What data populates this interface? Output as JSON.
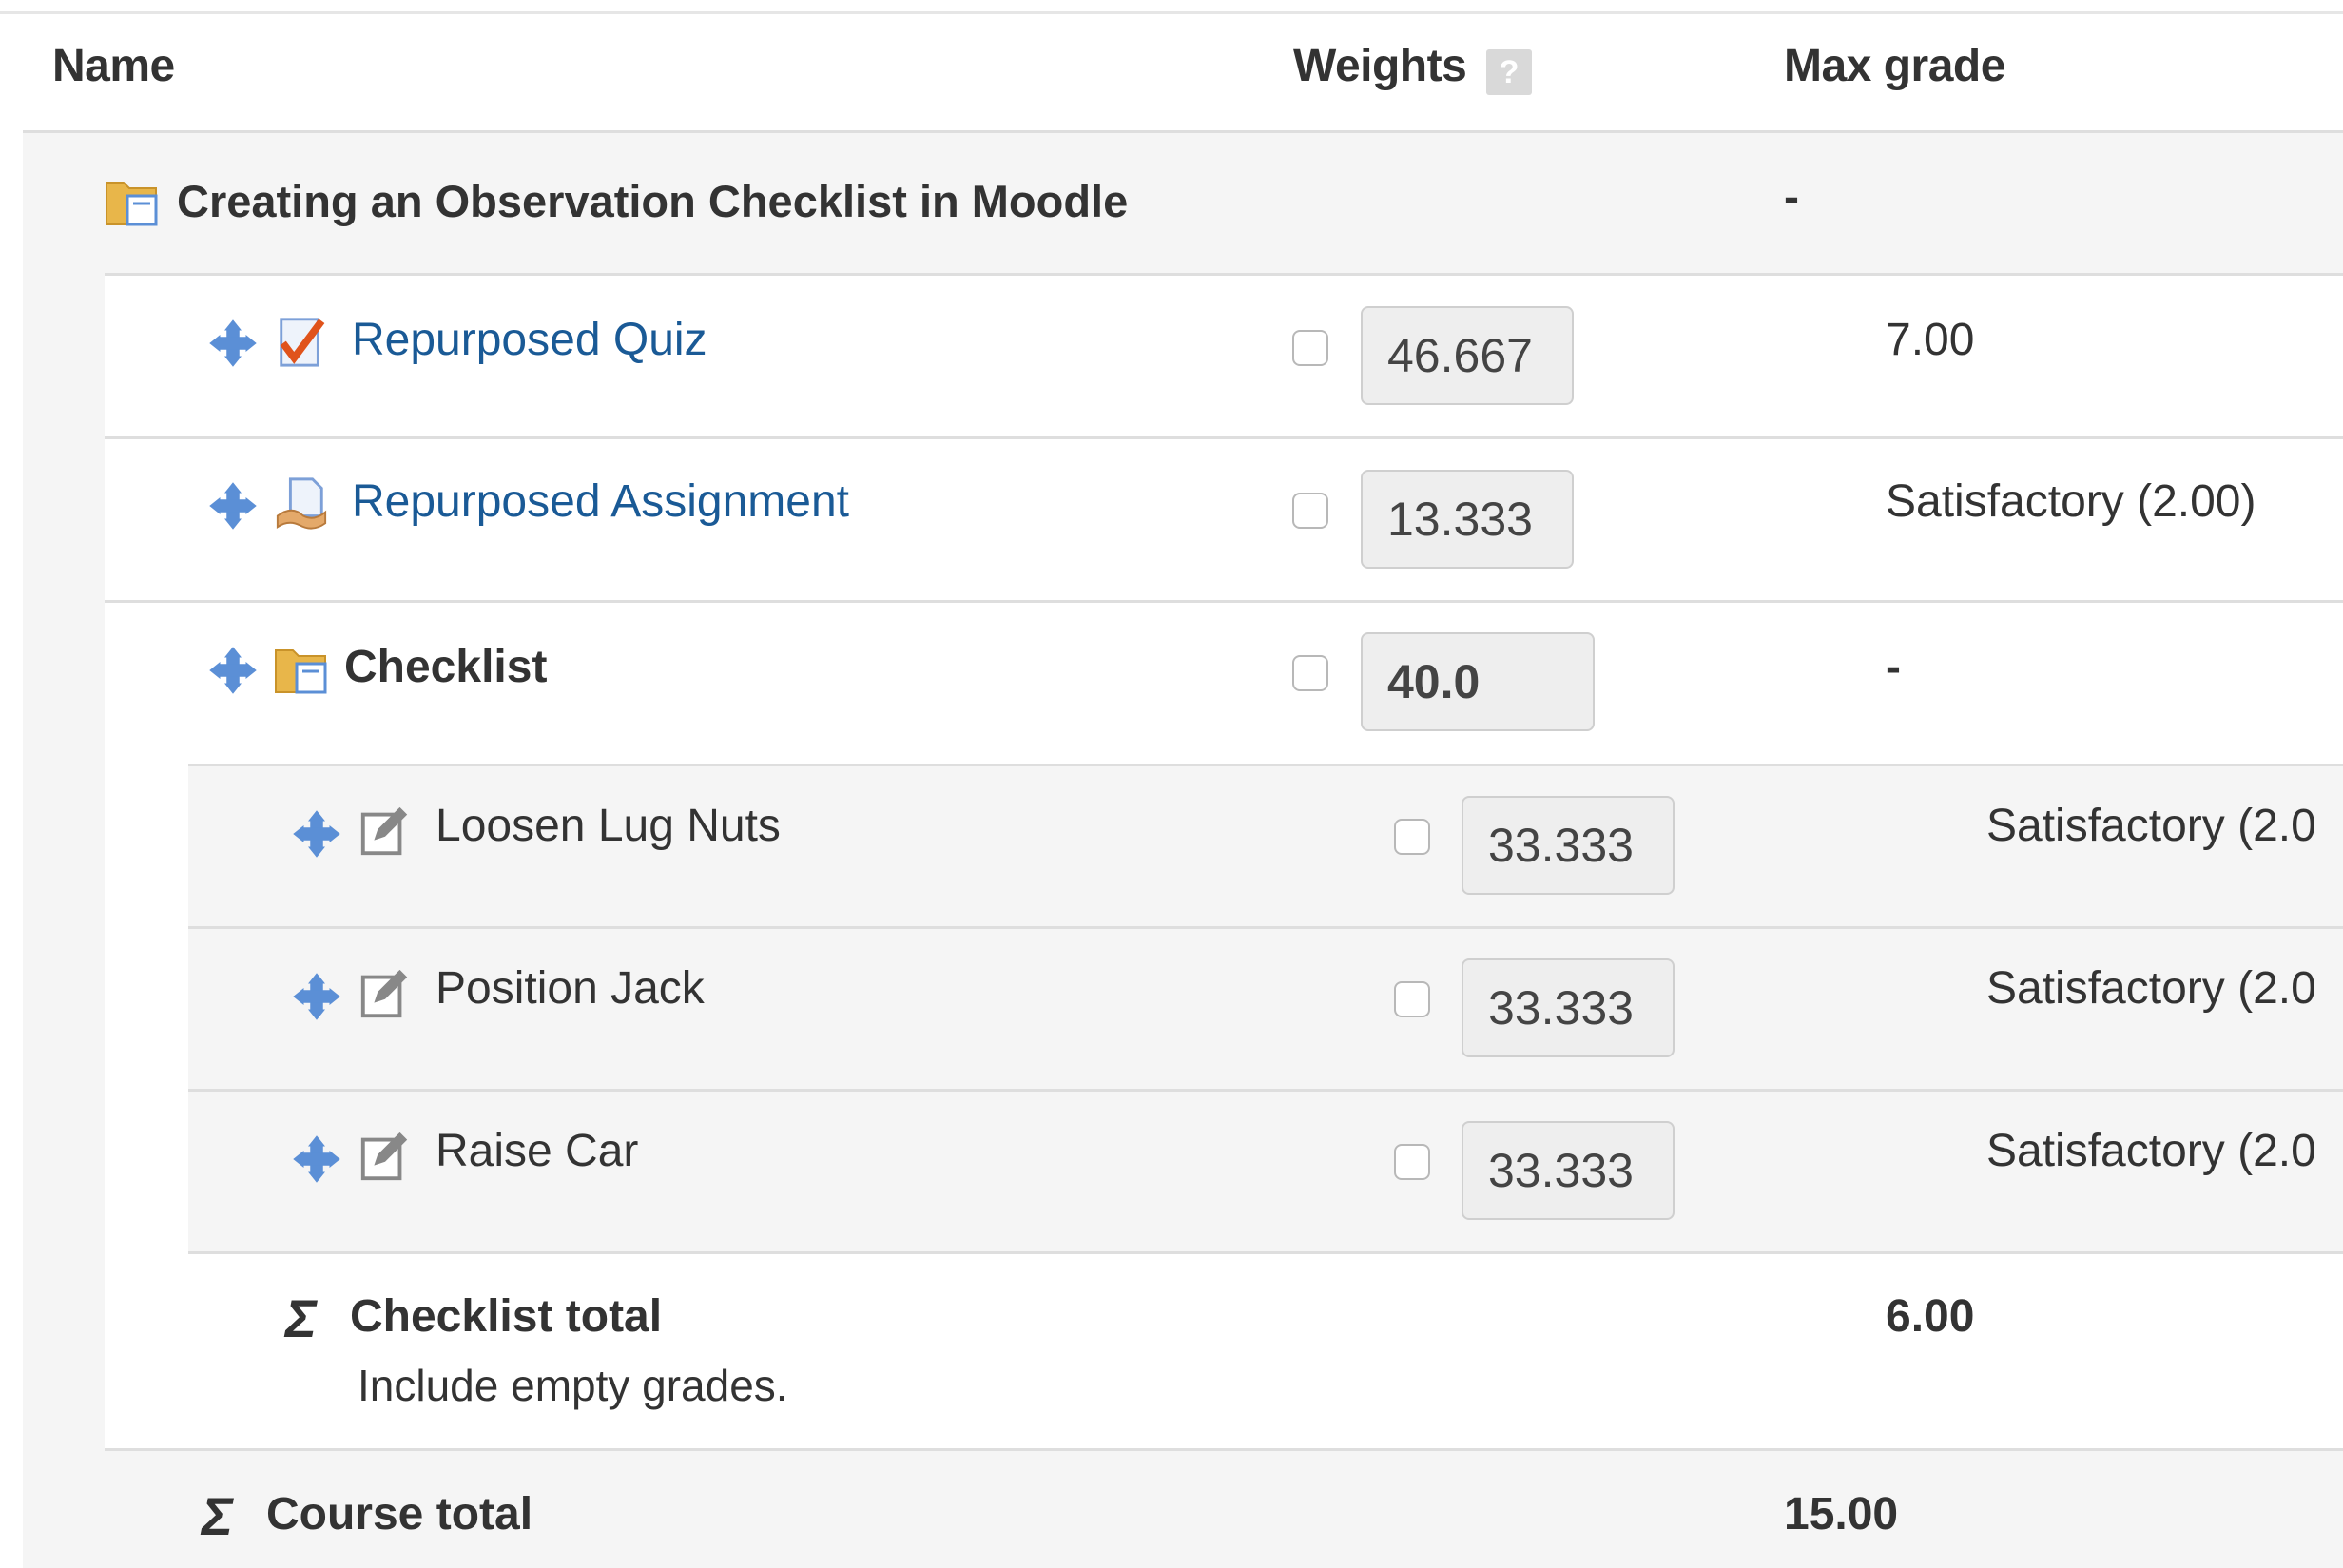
{
  "header": {
    "name": "Name",
    "weights": "Weights",
    "help_icon_glyph": "?",
    "max_grade": "Max grade"
  },
  "category": {
    "name": "Creating an Observation Checklist in Moodle",
    "max_grade": "-"
  },
  "items": [
    {
      "name": "Repurposed Quiz",
      "weight": "46.667",
      "max_grade": "7.00",
      "icon": "quiz-icon"
    },
    {
      "name": "Repurposed Assignment",
      "weight": "13.333",
      "max_grade": "Satisfactory (2.00)",
      "icon": "assignment-icon"
    }
  ],
  "checklist": {
    "name": "Checklist",
    "weight": "40.0",
    "max_grade": "-"
  },
  "sub_items": [
    {
      "name": "Loosen Lug Nuts",
      "weight": "33.333",
      "max_grade": "Satisfactory (2.0"
    },
    {
      "name": "Position Jack",
      "weight": "33.333",
      "max_grade": "Satisfactory (2.0"
    },
    {
      "name": "Raise Car",
      "weight": "33.333",
      "max_grade": "Satisfactory (2.0"
    }
  ],
  "checklist_total": {
    "sigma": "Σ",
    "name": "Checklist total",
    "note": "Include empty grades.",
    "max_grade": "6.00"
  },
  "course_total": {
    "sigma": "Σ",
    "name": "Course total",
    "max_grade": "15.00"
  },
  "colors": {
    "link": "#1a5a96",
    "move_icon": "#5b8fd6",
    "folder": "#e8b64a",
    "band_bg": "#f5f5f5"
  }
}
